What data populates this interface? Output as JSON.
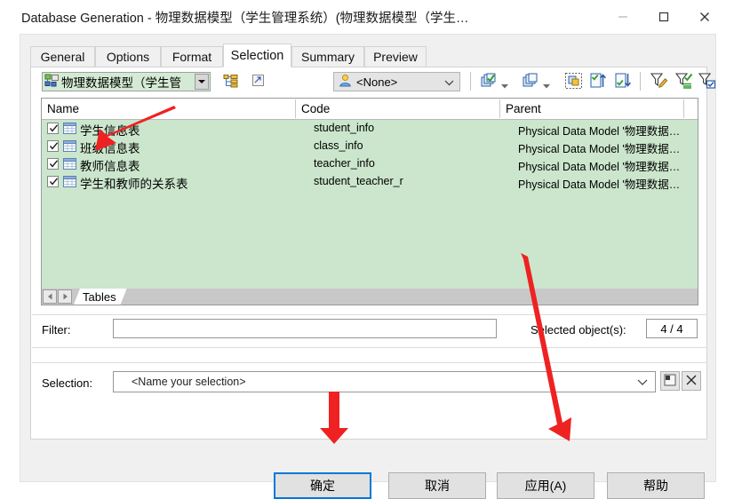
{
  "window": {
    "title": "Database Generation - 物理数据模型（学生管理系统）(物理数据模型（学生…",
    "minimize_label": "—",
    "maximize_label": "▢",
    "close_label": "✕"
  },
  "tabs": [
    {
      "label": "General",
      "active": false
    },
    {
      "label": "Options",
      "active": false
    },
    {
      "label": "Format",
      "active": false
    },
    {
      "label": "Selection",
      "active": true
    },
    {
      "label": "Summary",
      "active": false
    },
    {
      "label": "Preview",
      "active": false
    }
  ],
  "toolbar": {
    "model_combo_value": "物理数据模型（学生管",
    "model_combo_icon": "model-tree-icon",
    "model_dropdown_icon": "chevron-down-icon",
    "include_sub_icon": "tree-hierarchy-icon",
    "external_shortcut_icon": "external-shortcut-icon",
    "user_combo_value": "<None>",
    "user_combo_icon": "user-icon",
    "user_dropdown_icon": "chevron-down-icon",
    "select_all_icon": "select-all-icon",
    "select_all_caret_icon": "caret-down-icon",
    "deselect_all_icon": "deselect-all-icon",
    "deselect_all_caret_icon": "caret-down-icon",
    "invert_selection_icon": "invert-selection-icon",
    "select_related_up_icon": "select-up-icon",
    "select_related_down_icon": "select-down-icon",
    "edit_filter_icon": "filter-edit-icon",
    "apply_filter_icon": "filter-apply-icon",
    "filter_options_icon": "filter-options-icon"
  },
  "list": {
    "columns": [
      {
        "key": "name",
        "label": "Name"
      },
      {
        "key": "code",
        "label": "Code"
      },
      {
        "key": "parent",
        "label": "Parent"
      }
    ],
    "rows": [
      {
        "checked": true,
        "icon": "table-icon",
        "name": "学生信息表",
        "code": "student_info",
        "parent": "Physical Data Model '物理数据…"
      },
      {
        "checked": true,
        "icon": "table-icon",
        "name": "班级信息表",
        "code": "class_info",
        "parent": "Physical Data Model '物理数据…"
      },
      {
        "checked": true,
        "icon": "table-icon",
        "name": "教师信息表",
        "code": "teacher_info",
        "parent": "Physical Data Model '物理数据…"
      },
      {
        "checked": true,
        "icon": "table-icon",
        "name": "学生和教师的关系表",
        "code": "student_teacher_r",
        "parent": "Physical Data Model '物理数据…"
      }
    ]
  },
  "sheetbar": {
    "prev_icon": "triangle-left-icon",
    "next_icon": "triangle-right-icon",
    "tab_label": "Tables"
  },
  "filter_row": {
    "label": "Filter:",
    "value": "",
    "placeholder": "",
    "selected_label": "Selected object(s):",
    "selected_count": "4 / 4"
  },
  "selection_row": {
    "label": "Selection:",
    "value": "<Name your selection>",
    "dropdown_icon": "chevron-down-icon",
    "save_icon": "save-selection-icon",
    "delete_icon": "delete-selection-icon"
  },
  "buttons": [
    {
      "label": "确定",
      "default": true,
      "name": "ok-button"
    },
    {
      "label": "取消",
      "default": false,
      "name": "cancel-button"
    },
    {
      "label": "应用(A)",
      "default": false,
      "name": "apply-button"
    },
    {
      "label": "帮助",
      "default": false,
      "name": "help-button"
    }
  ],
  "annotations": {
    "color": "#ee2222",
    "arrows": [
      {
        "name": "arrow-to-checkbox"
      },
      {
        "name": "arrow-to-ok-button"
      },
      {
        "name": "arrow-to-apply-button"
      }
    ]
  },
  "colors": {
    "list_background": "#cbe6cc",
    "accent": "#0078d7",
    "dialog_background": "#f0f0f0"
  }
}
